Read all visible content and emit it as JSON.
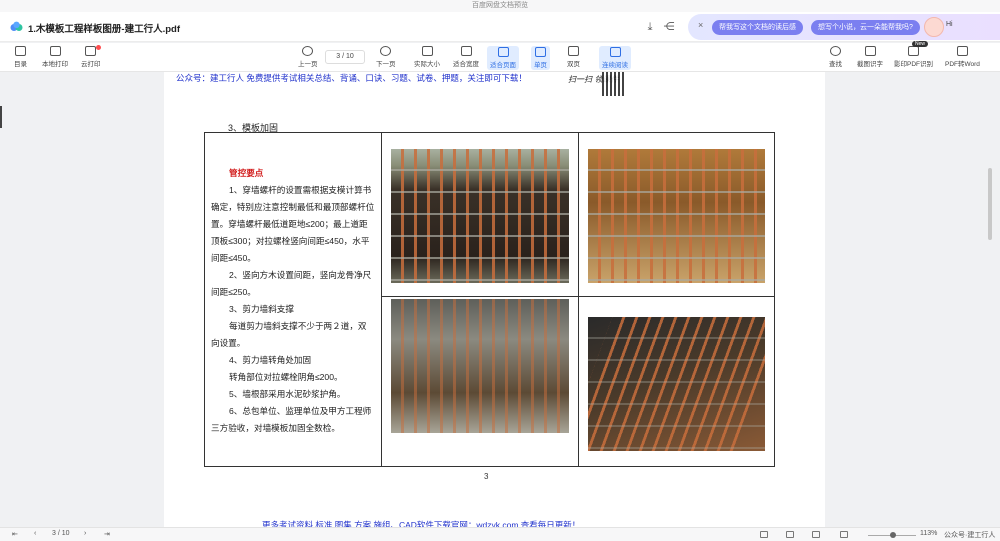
{
  "window": {
    "title": "百度网盘文档预览"
  },
  "file": {
    "name": "1.木模板工程样板图册-建工行人.pdf"
  },
  "ai": {
    "chip1": "帮我写这个文档的读后感",
    "chip2": "想写个小说，云一朵能帮我吗?",
    "greeting": "Hi"
  },
  "toolbar": {
    "left": [
      "目录",
      "本地打印",
      "云打印"
    ],
    "center": [
      "上一页",
      "下一页",
      "实际大小",
      "适合宽度",
      "适合页面",
      "单页",
      "双页",
      "连续阅读"
    ],
    "right": [
      "查找",
      "截图识字",
      "影印PDF识别",
      "PDF转Word"
    ],
    "new_badge": "New",
    "page_current": "3",
    "page_total": "/ 10"
  },
  "doc": {
    "header": "公众号：建工行人 免费提供考试相关总结、背诵、口诀、习题、试卷、押题，关注即可下载！",
    "stamp": "扫一扫 领课件",
    "section": "3、模板加固",
    "title": "管控要点",
    "paragraphs": [
      "1、穿墙螺杆的设置需根据支模计算书确定，特别应注意控制最低和最顶部螺杆位置。穿墙螺杆最低道距地≤200；最上道距顶板≤300；对拉螺栓竖向间距≤450，水平间距≤450。",
      "2、竖向方木设置间距，竖向龙骨净尺间距≤250。",
      "3、剪力墙斜支撑",
      "每道剪力墙斜支撑不少于两２道，双向设置。",
      "4、剪力墙转角处加固",
      "转角部位对拉螺栓阴角≤200。",
      "5、墙根部采用水泥砂浆护角。",
      "6、总包单位、监理单位及甲方工程师三方验收，对墙模板加固全数检。"
    ],
    "page_number": "3",
    "footer": "更多考试资料 标准 图集 方案 施组、CAD软件下载官网：wdzyk.com 查看每日更新！"
  },
  "status": {
    "page": "3 / 10",
    "zoom": "113%",
    "watermark": "公众号·建工行人"
  },
  "colors": {
    "accent": "#2f6fe4",
    "header_blue": "#2233cc",
    "title_red": "#d21f1f"
  }
}
